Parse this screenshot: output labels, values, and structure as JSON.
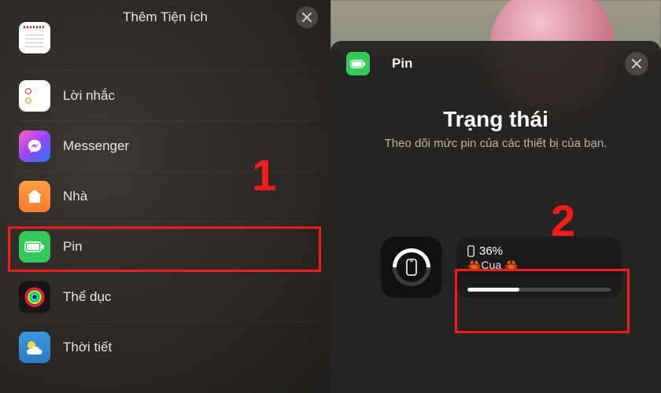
{
  "left": {
    "title": "Thêm Tiện ích",
    "apps": [
      {
        "label": "",
        "icon": "calendar"
      },
      {
        "label": "Lời nhắc",
        "icon": "reminders"
      },
      {
        "label": "Messenger",
        "icon": "messenger"
      },
      {
        "label": "Nhà",
        "icon": "home"
      },
      {
        "label": "Pin",
        "icon": "battery"
      },
      {
        "label": "Thể dục",
        "icon": "fitness"
      },
      {
        "label": "Thời tiết",
        "icon": "weather"
      }
    ]
  },
  "right": {
    "sheet_title": "Pin",
    "status_title": "Trạng thái",
    "status_subtitle": "Theo dõi mức pin của các thiết bị của bạn.",
    "widget": {
      "percent_label": "36%",
      "percent_value": 36,
      "device_name": "🦀Cua 🦀"
    }
  },
  "markers": {
    "one": "1",
    "two": "2"
  },
  "colors": {
    "accent_red": "#ff1a1a",
    "battery_green": "#34c759"
  }
}
